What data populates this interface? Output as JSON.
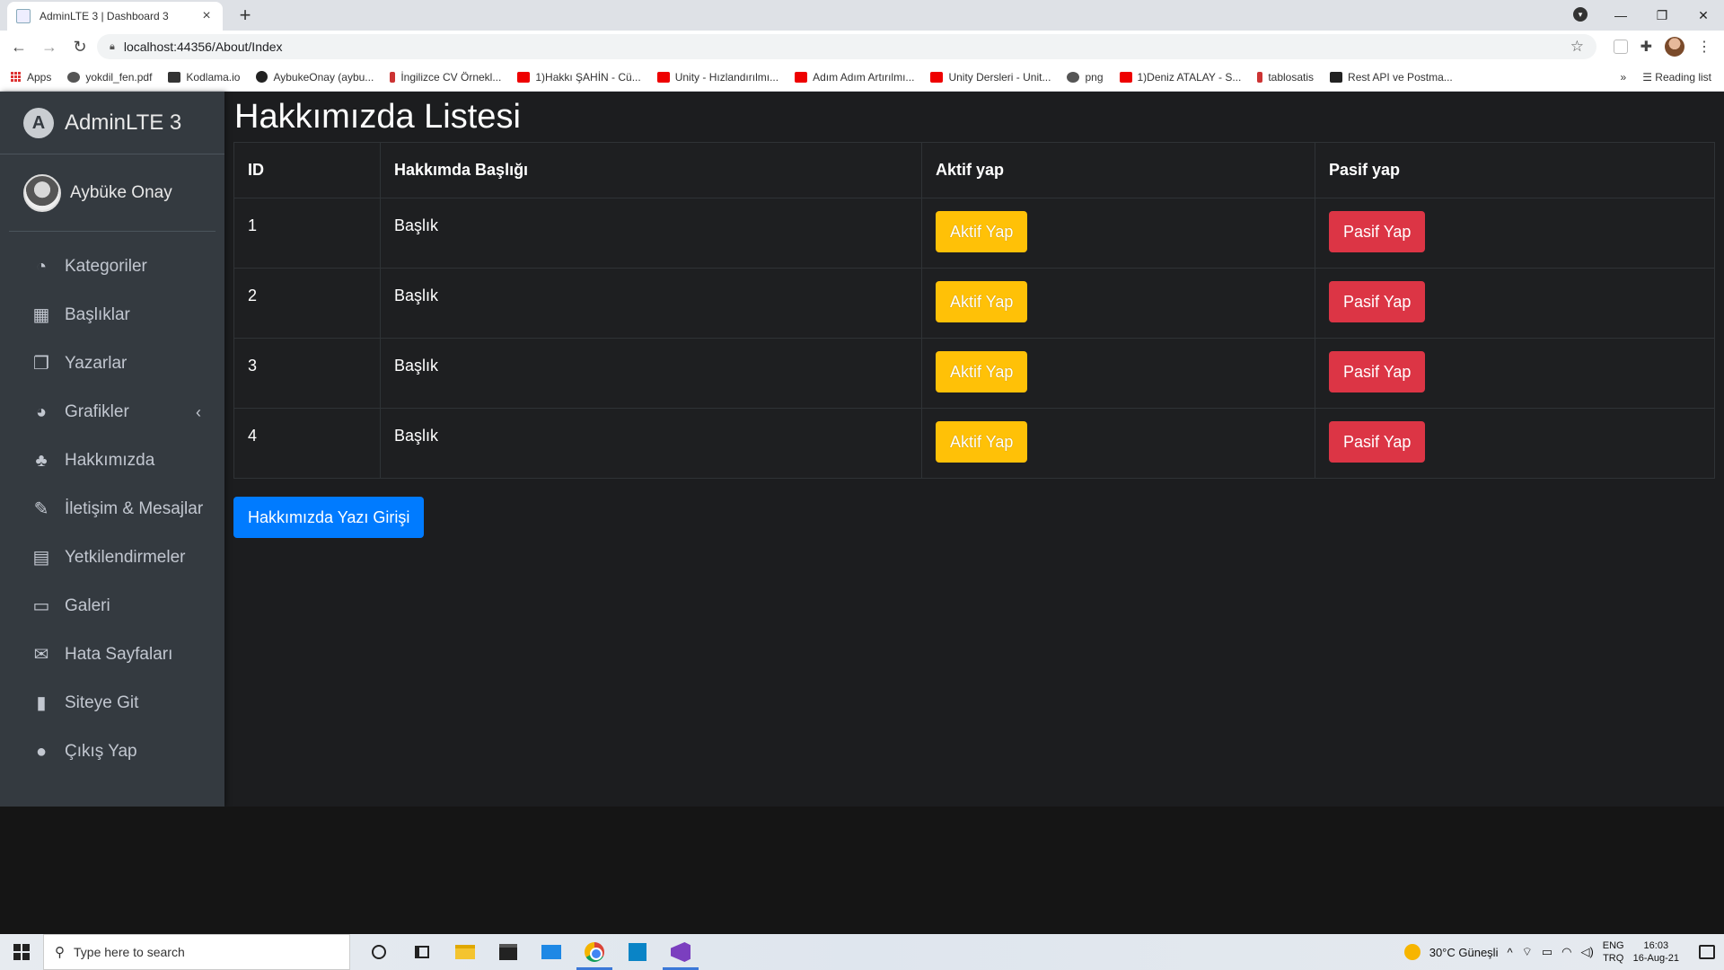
{
  "browser": {
    "tab_title": "AdminLTE 3 | Dashboard 3",
    "url": "localhost:44356/About/Index",
    "bookmarks": [
      {
        "label": "Apps",
        "icon": "apps"
      },
      {
        "label": "yokdil_fen.pdf",
        "icon": "g"
      },
      {
        "label": "Kodlama.io",
        "icon": "k"
      },
      {
        "label": "AybukeOnay (aybu...",
        "icon": "gh"
      },
      {
        "label": "İngilizce CV Örnekl...",
        "icon": "r"
      },
      {
        "label": "1)Hakkı ŞAHİN - Cü...",
        "icon": "yt"
      },
      {
        "label": "Unity - Hızlandırılmı...",
        "icon": "yt"
      },
      {
        "label": "Adım Adım Artırılmı...",
        "icon": "yt"
      },
      {
        "label": "Unity Dersleri - Unit...",
        "icon": "yt"
      },
      {
        "label": "png",
        "icon": "g"
      },
      {
        "label": "1)Deniz ATALAY - S...",
        "icon": "yt"
      },
      {
        "label": "tablosatis",
        "icon": "r"
      },
      {
        "label": "Rest API ve Postma...",
        "icon": "h"
      }
    ],
    "reading_list": "Reading list",
    "overflow": "»"
  },
  "sidebar": {
    "brand": "AdminLTE 3",
    "brand_logo_letter": "A",
    "user_name": "Aybüke Onay",
    "items": [
      {
        "label": "Kategoriler",
        "icon": "tachometer-icon",
        "glyph": "◔"
      },
      {
        "label": "Başlıklar",
        "icon": "grid-icon",
        "glyph": "▦"
      },
      {
        "label": "Yazarlar",
        "icon": "copy-icon",
        "glyph": "❐"
      },
      {
        "label": "Grafikler",
        "icon": "pie-chart-icon",
        "glyph": "◕",
        "chevron": "‹"
      },
      {
        "label": "Hakkımızda",
        "icon": "tree-icon",
        "glyph": "♣"
      },
      {
        "label": "İletişim & Mesajlar",
        "icon": "edit-icon",
        "glyph": "✎"
      },
      {
        "label": "Yetkilendirmeler",
        "icon": "calendar-icon",
        "glyph": "▤"
      },
      {
        "label": "Galeri",
        "icon": "image-icon",
        "glyph": "▭"
      },
      {
        "label": "Hata Sayfaları",
        "icon": "envelope-icon",
        "glyph": "✉"
      },
      {
        "label": "Siteye Git",
        "icon": "book-icon",
        "glyph": "▮"
      },
      {
        "label": "Çıkış Yap",
        "icon": "apple-icon",
        "glyph": "●"
      }
    ]
  },
  "main": {
    "title": "Hakkımızda Listesi",
    "columns": [
      "ID",
      "Hakkımda Başlığı",
      "Aktif yap",
      "Pasif yap"
    ],
    "rows": [
      {
        "id": "1",
        "title": "Başlık",
        "activate": "Aktif Yap",
        "deactivate": "Pasif Yap"
      },
      {
        "id": "2",
        "title": "Başlık",
        "activate": "Aktif Yap",
        "deactivate": "Pasif Yap"
      },
      {
        "id": "3",
        "title": "Başlık",
        "activate": "Aktif Yap",
        "deactivate": "Pasif Yap"
      },
      {
        "id": "4",
        "title": "Başlık",
        "activate": "Aktif Yap",
        "deactivate": "Pasif Yap"
      }
    ],
    "add_button": "Hakkımızda Yazı Girişi"
  },
  "taskbar": {
    "search_placeholder": "Type here to search",
    "weather": "30°C  Güneşli",
    "lang_top": "ENG",
    "lang_bottom": "TRQ",
    "time": "16:03",
    "date": "16-Aug-21"
  },
  "colors": {
    "sidebar_bg": "#343a40",
    "content_bg": "#1c1d1f",
    "warning": "#ffc107",
    "danger": "#dc3545",
    "primary": "#007bff"
  }
}
